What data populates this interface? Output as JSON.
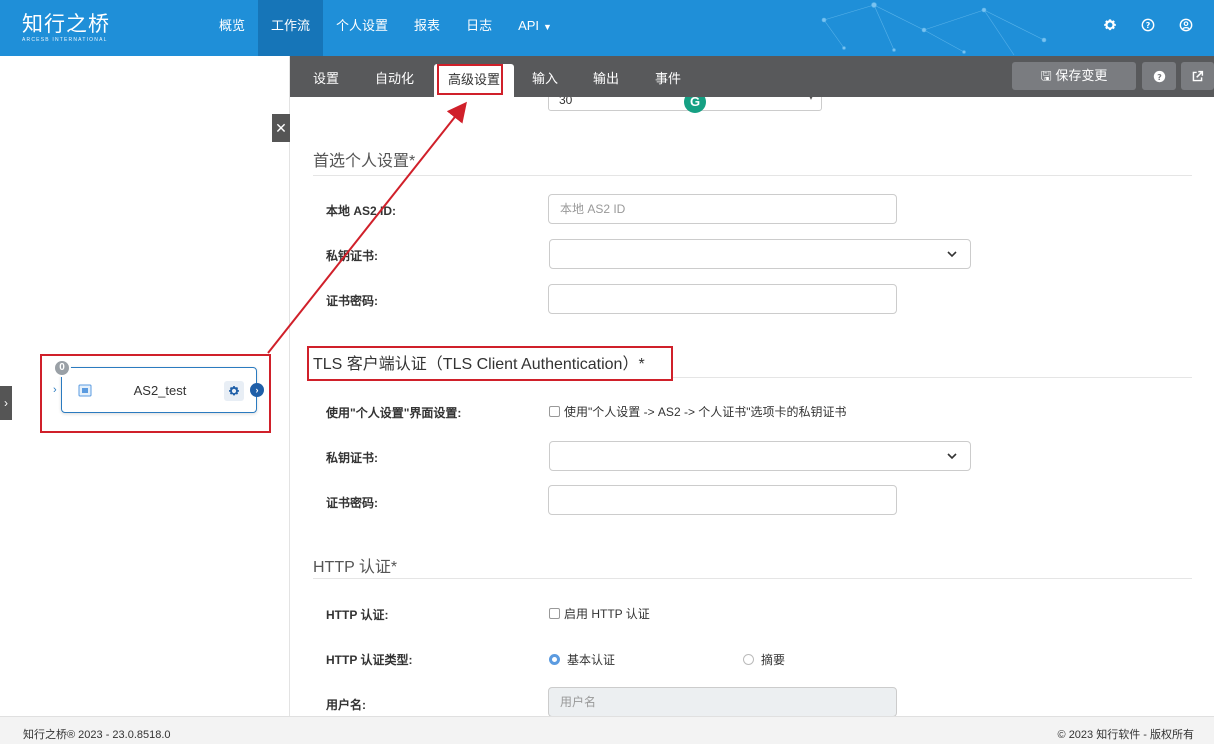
{
  "app": {
    "logo_cn": "知行之桥",
    "logo_en": "ARCESB INTERNATIONAL"
  },
  "nav": {
    "items": [
      {
        "label": "概览"
      },
      {
        "label": "工作流",
        "active": true
      },
      {
        "label": "个人设置"
      },
      {
        "label": "报表"
      },
      {
        "label": "日志"
      },
      {
        "label": "API"
      }
    ],
    "icons": [
      "gear-icon",
      "help-icon",
      "user-icon"
    ]
  },
  "canvas": {
    "node_label": "AS2_test",
    "node_badge": "0"
  },
  "tabs": {
    "items": [
      "设置",
      "自动化",
      "高级设置",
      "输入",
      "输出",
      "事件"
    ],
    "active": "高级设置",
    "save_label": "保存变更"
  },
  "form": {
    "partial_value": "30",
    "sections": {
      "preferred": {
        "title": "首选个人设置*",
        "local_as2_id_label": "本地 AS2 ID:",
        "local_as2_id_placeholder": "本地 AS2 ID",
        "private_cert_label": "私钥证书:",
        "cert_password_label": "证书密码:"
      },
      "tls": {
        "title": "TLS 客户端认证（TLS Client Authentication）*",
        "use_profile_label": "使用\"个人设置\"界面设置:",
        "use_profile_checkbox": "使用\"个人设置 -> AS2 -> 个人证书\"选项卡的私钥证书",
        "private_cert_label": "私钥证书:",
        "cert_password_label": "证书密码:"
      },
      "http": {
        "title": "HTTP 认证*",
        "http_auth_label": "HTTP 认证:",
        "http_auth_checkbox": "启用 HTTP 认证",
        "auth_type_label": "HTTP 认证类型:",
        "auth_type_options": [
          "基本认证",
          "摘要"
        ],
        "auth_type_selected": "基本认证",
        "username_label": "用户名:",
        "username_placeholder": "用户名"
      }
    }
  },
  "footer": {
    "left": "知行之桥® 2023 - 23.0.8518.0",
    "right": "© 2023 知行软件 - 版权所有"
  },
  "colors": {
    "nav_bg": "#1f8fd8",
    "nav_active": "#1675b8",
    "tabbar_bg": "#58595b",
    "highlight": "#d0202a"
  }
}
